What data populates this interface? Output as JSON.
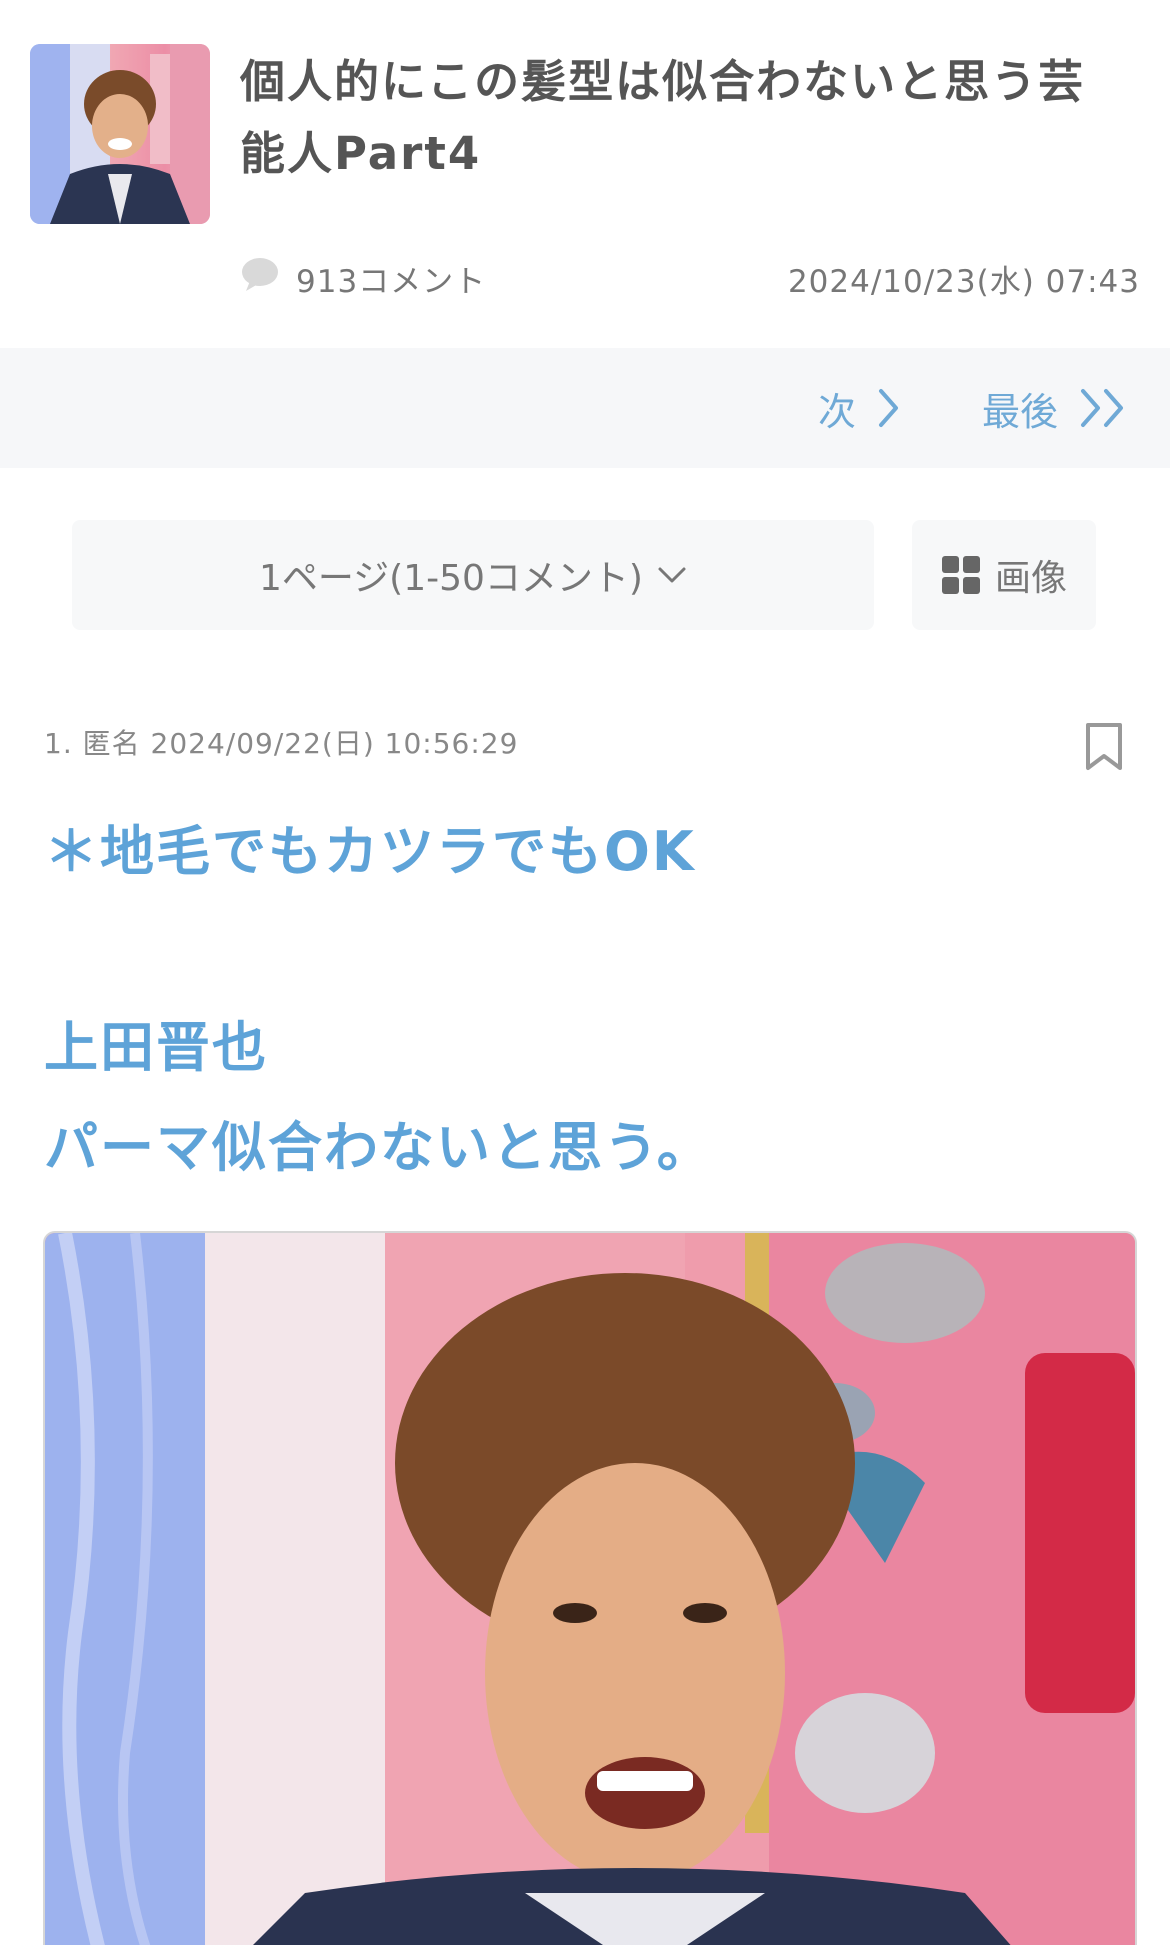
{
  "topic": {
    "title_line1": "個人的にこの髪型は似合わないと思う芸",
    "title_line2": "能人Part4",
    "comment_count": "913コメント",
    "date": "2024/10/23(水) 07:43"
  },
  "pager": {
    "next_label": "次",
    "last_label": "最後"
  },
  "page_select": {
    "selected": "1ページ(1-50コメント)"
  },
  "image_button": {
    "label": "画像"
  },
  "comment": {
    "meta": "1. 匿名 2024/09/22(日) 10:56:29",
    "lines": [
      "＊地毛でもカツラでもOK",
      "",
      "上田晋也",
      "パーマ似合わないと思う。"
    ]
  },
  "colors": {
    "accent": "#5ea3d8",
    "link": "#6fa9d6",
    "text_muted": "#777777",
    "bar_bg": "#f6f7f9"
  },
  "icons": {
    "comment": "speech-bubble-icon",
    "next": "chevron-right-icon",
    "last": "double-chevron-right-icon",
    "dropdown": "chevron-down-icon",
    "grid": "grid-icon",
    "bookmark": "bookmark-icon"
  }
}
